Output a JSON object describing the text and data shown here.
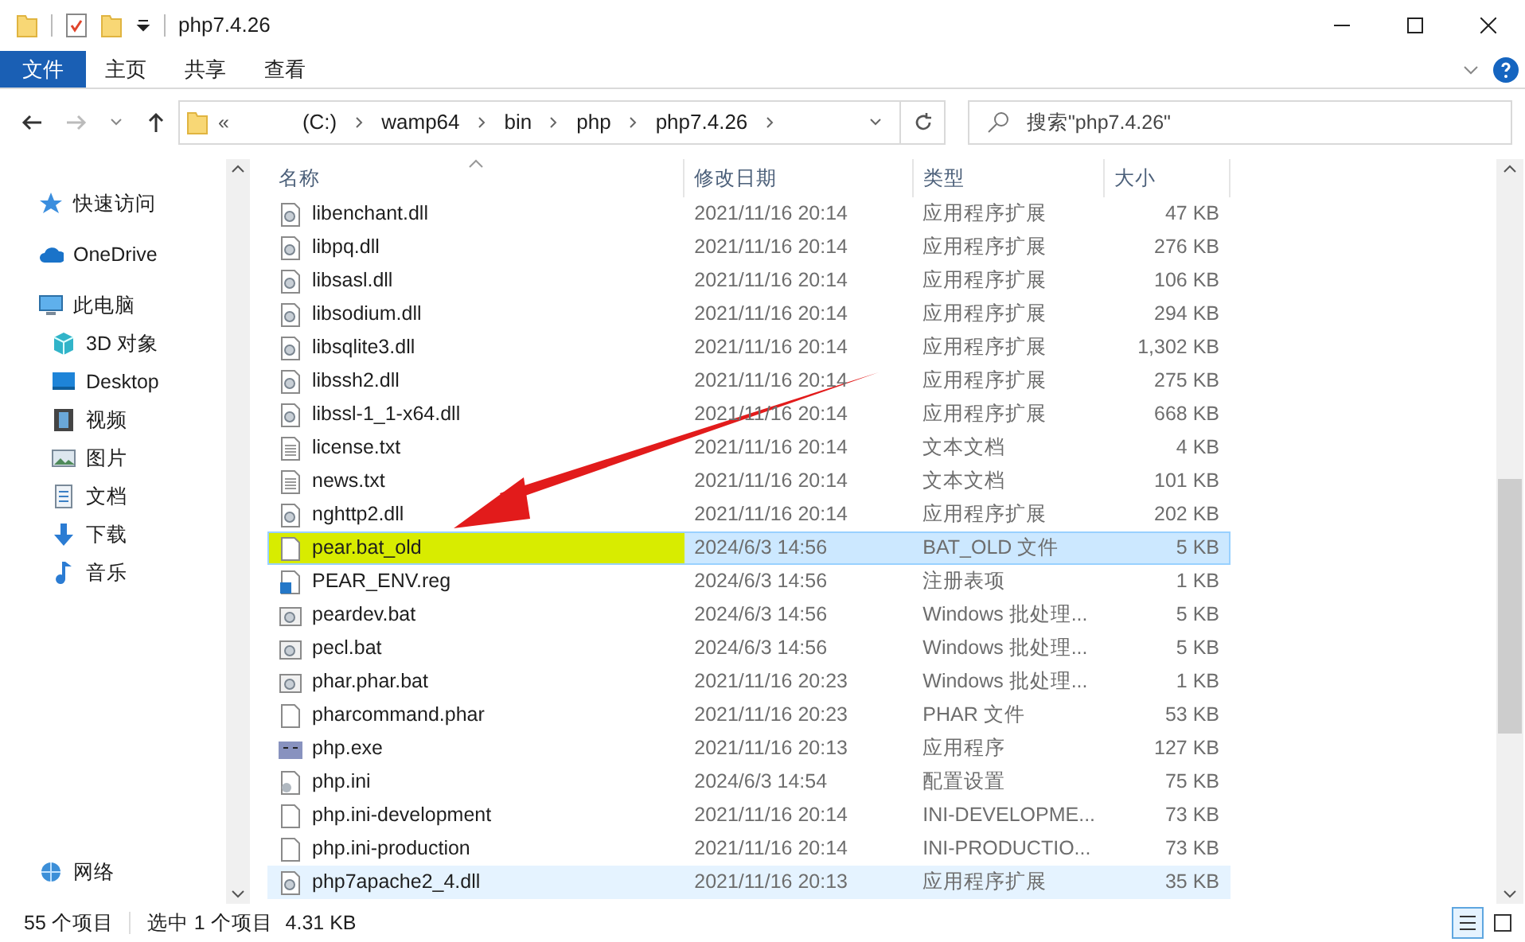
{
  "window": {
    "title": "php7.4.26"
  },
  "ribbon_tabs": [
    {
      "label": "文件",
      "selected": true
    },
    {
      "label": "主页",
      "selected": false
    },
    {
      "label": "共享",
      "selected": false
    },
    {
      "label": "查看",
      "selected": false
    }
  ],
  "address": {
    "overflow": "«",
    "crumbs": [
      "(C:)",
      "wamp64",
      "bin",
      "php",
      "php7.4.26"
    ]
  },
  "search": {
    "placeholder": "搜索\"php7.4.26\""
  },
  "sidebar": {
    "items": [
      {
        "label": "快速访问",
        "kind": "star"
      },
      {
        "label": "OneDrive",
        "kind": "cloud"
      },
      {
        "label": "此电脑",
        "kind": "pc",
        "children": [
          {
            "label": "3D 对象",
            "kind": "cube"
          },
          {
            "label": "Desktop",
            "kind": "desktop"
          },
          {
            "label": "视频",
            "kind": "film"
          },
          {
            "label": "图片",
            "kind": "image"
          },
          {
            "label": "文档",
            "kind": "doc"
          },
          {
            "label": "下载",
            "kind": "download"
          },
          {
            "label": "音乐",
            "kind": "music"
          }
        ]
      }
    ],
    "bottom_items": [
      {
        "label": "网络",
        "kind": "network"
      }
    ]
  },
  "table": {
    "columns": [
      "名称",
      "修改日期",
      "类型",
      "大小"
    ],
    "rows": [
      {
        "name": "libenchant.dll",
        "date": "2021/11/16 20:14",
        "type": "应用程序扩展",
        "size": "47 KB",
        "kind": "dll",
        "selected": false,
        "hovered": false,
        "marked": false
      },
      {
        "name": "libpq.dll",
        "date": "2021/11/16 20:14",
        "type": "应用程序扩展",
        "size": "276 KB",
        "kind": "dll",
        "selected": false,
        "hovered": false,
        "marked": false
      },
      {
        "name": "libsasl.dll",
        "date": "2021/11/16 20:14",
        "type": "应用程序扩展",
        "size": "106 KB",
        "kind": "dll",
        "selected": false,
        "hovered": false,
        "marked": false
      },
      {
        "name": "libsodium.dll",
        "date": "2021/11/16 20:14",
        "type": "应用程序扩展",
        "size": "294 KB",
        "kind": "dll",
        "selected": false,
        "hovered": false,
        "marked": false
      },
      {
        "name": "libsqlite3.dll",
        "date": "2021/11/16 20:14",
        "type": "应用程序扩展",
        "size": "1,302 KB",
        "kind": "dll",
        "selected": false,
        "hovered": false,
        "marked": false
      },
      {
        "name": "libssh2.dll",
        "date": "2021/11/16 20:14",
        "type": "应用程序扩展",
        "size": "275 KB",
        "kind": "dll",
        "selected": false,
        "hovered": false,
        "marked": false
      },
      {
        "name": "libssl-1_1-x64.dll",
        "date": "2021/11/16 20:14",
        "type": "应用程序扩展",
        "size": "668 KB",
        "kind": "dll",
        "selected": false,
        "hovered": false,
        "marked": false
      },
      {
        "name": "license.txt",
        "date": "2021/11/16 20:14",
        "type": "文本文档",
        "size": "4 KB",
        "kind": "txt",
        "selected": false,
        "hovered": false,
        "marked": false
      },
      {
        "name": "news.txt",
        "date": "2021/11/16 20:14",
        "type": "文本文档",
        "size": "101 KB",
        "kind": "txt",
        "selected": false,
        "hovered": false,
        "marked": false
      },
      {
        "name": "nghttp2.dll",
        "date": "2021/11/16 20:14",
        "type": "应用程序扩展",
        "size": "202 KB",
        "kind": "dll",
        "selected": false,
        "hovered": false,
        "marked": false
      },
      {
        "name": "pear.bat_old",
        "date": "2024/6/3 14:56",
        "type": "BAT_OLD 文件",
        "size": "5 KB",
        "kind": "blank",
        "selected": true,
        "hovered": false,
        "marked": true
      },
      {
        "name": "PEAR_ENV.reg",
        "date": "2024/6/3 14:56",
        "type": "注册表项",
        "size": "1 KB",
        "kind": "reg",
        "selected": false,
        "hovered": false,
        "marked": false
      },
      {
        "name": "peardev.bat",
        "date": "2024/6/3 14:56",
        "type": "Windows 批处理...",
        "size": "5 KB",
        "kind": "bat",
        "selected": false,
        "hovered": false,
        "marked": false
      },
      {
        "name": "pecl.bat",
        "date": "2024/6/3 14:56",
        "type": "Windows 批处理...",
        "size": "5 KB",
        "kind": "bat",
        "selected": false,
        "hovered": false,
        "marked": false
      },
      {
        "name": "phar.phar.bat",
        "date": "2021/11/16 20:23",
        "type": "Windows 批处理...",
        "size": "1 KB",
        "kind": "bat",
        "selected": false,
        "hovered": false,
        "marked": false
      },
      {
        "name": "pharcommand.phar",
        "date": "2021/11/16 20:23",
        "type": "PHAR 文件",
        "size": "53 KB",
        "kind": "blank",
        "selected": false,
        "hovered": false,
        "marked": false
      },
      {
        "name": "php.exe",
        "date": "2021/11/16 20:13",
        "type": "应用程序",
        "size": "127 KB",
        "kind": "php",
        "selected": false,
        "hovered": false,
        "marked": false
      },
      {
        "name": "php.ini",
        "date": "2024/6/3 14:54",
        "type": "配置设置",
        "size": "75 KB",
        "kind": "ini",
        "selected": false,
        "hovered": false,
        "marked": false
      },
      {
        "name": "php.ini-development",
        "date": "2021/11/16 20:14",
        "type": "INI-DEVELOPME...",
        "size": "73 KB",
        "kind": "blank",
        "selected": false,
        "hovered": false,
        "marked": false
      },
      {
        "name": "php.ini-production",
        "date": "2021/11/16 20:14",
        "type": "INI-PRODUCTIO...",
        "size": "73 KB",
        "kind": "blank",
        "selected": false,
        "hovered": false,
        "marked": false
      },
      {
        "name": "php7apache2_4.dll",
        "date": "2021/11/16 20:13",
        "type": "应用程序扩展",
        "size": "35 KB",
        "kind": "dll",
        "selected": false,
        "hovered": true,
        "marked": false
      }
    ]
  },
  "annotation": {
    "kind": "arrow"
  },
  "status_bar": {
    "count": "55 个项目",
    "selection": "选中 1 个项目",
    "size": "4.31 KB"
  }
}
